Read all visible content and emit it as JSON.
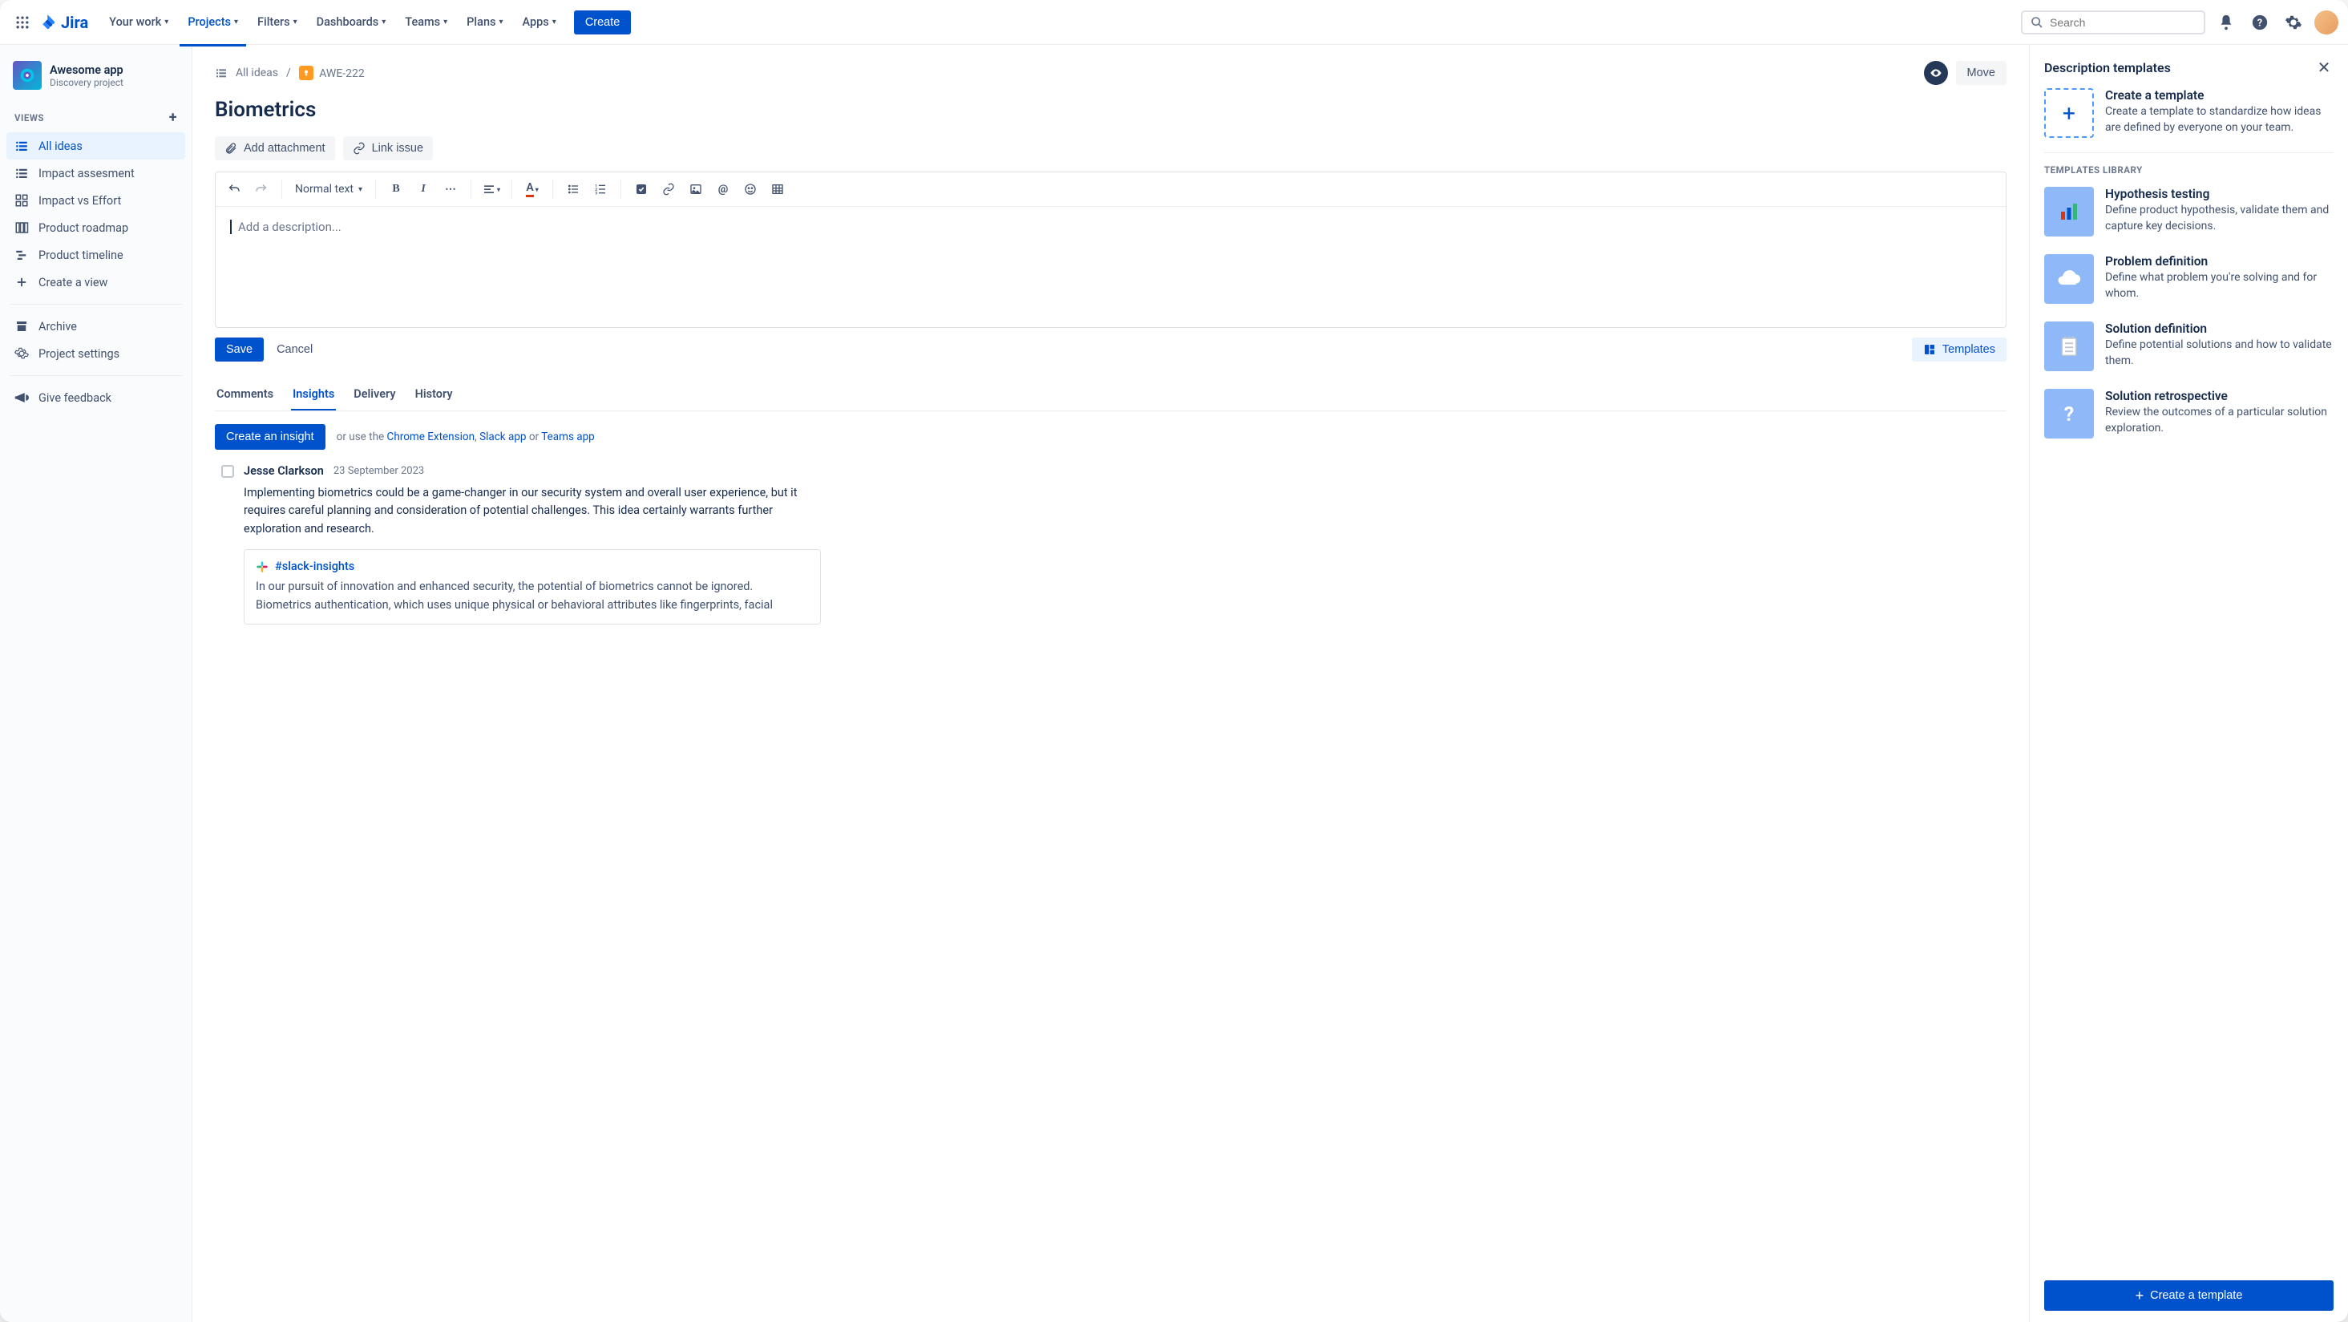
{
  "nav": {
    "product": "Jira",
    "items": [
      "Your work",
      "Projects",
      "Filters",
      "Dashboards",
      "Teams",
      "Plans",
      "Apps"
    ],
    "activeIndex": 1,
    "create": "Create",
    "searchPlaceholder": "Search"
  },
  "sidebar": {
    "project": {
      "name": "Awesome app",
      "subtitle": "Discovery project"
    },
    "viewsHeader": "VIEWS",
    "items": [
      {
        "label": "All ideas",
        "icon": "list",
        "active": true
      },
      {
        "label": "Impact assesment",
        "icon": "list"
      },
      {
        "label": "Impact vs Effort",
        "icon": "grid"
      },
      {
        "label": "Product roadmap",
        "icon": "columns"
      },
      {
        "label": "Product timeline",
        "icon": "timeline"
      },
      {
        "label": "Create a view",
        "icon": "plus"
      }
    ],
    "archive": "Archive",
    "settings": "Project settings",
    "feedback": "Give feedback"
  },
  "breadcrumb": {
    "root": "All ideas",
    "issueKey": "AWE-222",
    "move": "Move"
  },
  "issue": {
    "title": "Biometrics",
    "addAttachment": "Add attachment",
    "linkIssue": "Link issue",
    "textStyle": "Normal text",
    "placeholder": "Add a description...",
    "save": "Save",
    "cancel": "Cancel",
    "templates": "Templates"
  },
  "tabs": [
    "Comments",
    "Insights",
    "Delivery",
    "History"
  ],
  "activeTab": 1,
  "insights": {
    "createBtn": "Create an insight",
    "hintPrefix": "or use the ",
    "links": {
      "chrome": "Chrome Extension",
      "slack": "Slack app",
      "teams": "Teams app"
    },
    "hintMiddle": ", ",
    "hintOr": " or ",
    "entry": {
      "author": "Jesse Clarkson",
      "date": "23 September 2023",
      "body": "Implementing biometrics could be a game-changer in our security system and overall user experience, but it requires careful planning and consideration of potential challenges. This idea certainly warrants further exploration and research.",
      "slackChannel": "#slack-insights",
      "slackBody": "In our pursuit of innovation and enhanced security, the potential of biometrics cannot be ignored. Biometrics authentication, which uses unique physical or behavioral attributes like fingerprints, facial"
    }
  },
  "panel": {
    "title": "Description templates",
    "create": {
      "title": "Create a template",
      "sub": "Create a template to standardize how ideas are defined by everyone on your team."
    },
    "library": "TEMPLATES LIBRARY",
    "items": [
      {
        "title": "Hypothesis testing",
        "sub": "Define product hypothesis, validate them and capture key decisions.",
        "color": "#8EB8F7",
        "icon": "chart"
      },
      {
        "title": "Problem definition",
        "sub": "Define what problem you're solving and for whom.",
        "color": "#8EB8F7",
        "icon": "cloud"
      },
      {
        "title": "Solution definition",
        "sub": "Define potential solutions and how to validate them.",
        "color": "#8EB8F7",
        "icon": "notepad"
      },
      {
        "title": "Solution retrospective",
        "sub": "Review the outcomes of a particular solution exploration.",
        "color": "#8EB8F7",
        "icon": "question"
      }
    ],
    "cta": "Create a template"
  }
}
